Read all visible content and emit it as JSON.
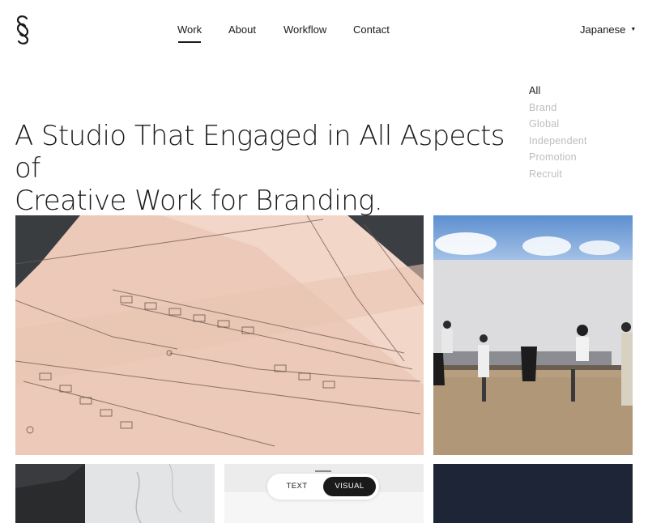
{
  "brand": {
    "logo_icon": "s-logo-icon"
  },
  "nav": {
    "items": [
      {
        "label": "Work",
        "active": true
      },
      {
        "label": "About",
        "active": false
      },
      {
        "label": "Workflow",
        "active": false
      },
      {
        "label": "Contact",
        "active": false
      }
    ]
  },
  "language": {
    "label": "Japanese",
    "icon": "caret-down-icon"
  },
  "headline": {
    "line1": "A Studio That Engaged in All Aspects of",
    "line2": "Creative Work for Branding."
  },
  "filters": {
    "items": [
      {
        "label": "All",
        "active": true
      },
      {
        "label": "Brand",
        "active": false
      },
      {
        "label": "Global",
        "active": false
      },
      {
        "label": "Independent",
        "active": false
      },
      {
        "label": "Promotion",
        "active": false
      },
      {
        "label": "Recruit",
        "active": false
      }
    ]
  },
  "view_toggle": {
    "text_label": "TEXT",
    "visual_label": "VISUAL",
    "selected": "VISUAL"
  },
  "colors": {
    "text": "#1a1a1a",
    "muted": "#bdbdbd",
    "blueprint": "#efcfc1",
    "navy": "#1e2537"
  }
}
